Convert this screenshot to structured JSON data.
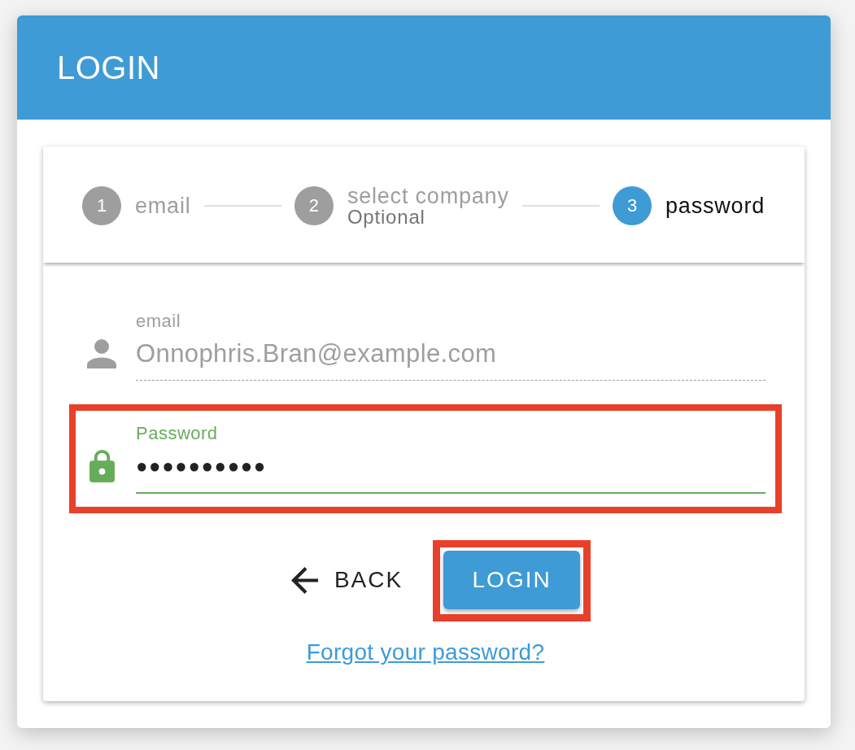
{
  "header": {
    "title": "LOGIN"
  },
  "stepper": {
    "steps": [
      {
        "number": "1",
        "label": "email",
        "active": false
      },
      {
        "number": "2",
        "label": "select company",
        "sublabel": "Optional",
        "active": false
      },
      {
        "number": "3",
        "label": "password",
        "active": true
      }
    ]
  },
  "fields": [
    {
      "kind": "email",
      "label": "email",
      "value": "Onnophris.Bran@example.com",
      "disabled": true,
      "valid": false,
      "highlighted": false
    },
    {
      "kind": "password",
      "label": "Password",
      "value": "●●●●●●●●●●",
      "disabled": false,
      "valid": true,
      "highlighted": true
    }
  ],
  "actions": {
    "back": {
      "label": "BACK"
    },
    "login": {
      "label": "LOGIN",
      "highlighted": true
    }
  },
  "forgot_link": "Forgot your password?"
}
